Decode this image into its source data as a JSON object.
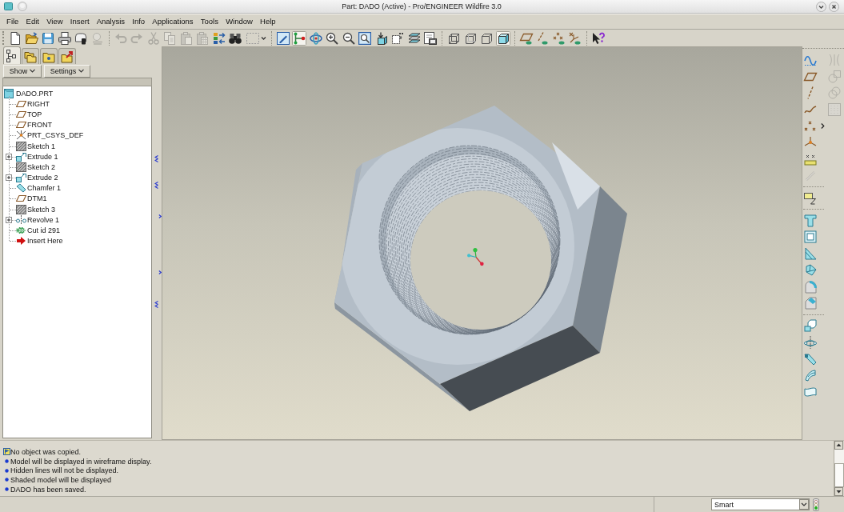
{
  "window": {
    "title": "Part: DADO (Active) - Pro/ENGINEER Wildfire 3.0"
  },
  "menu": [
    "File",
    "Edit",
    "View",
    "Insert",
    "Analysis",
    "Info",
    "Applications",
    "Tools",
    "Window",
    "Help"
  ],
  "toolbar": {
    "groups": [
      {
        "items": [
          {
            "disabled": false,
            "pressed": false
          },
          {
            "disabled": false,
            "pressed": false
          },
          {
            "disabled": false,
            "pressed": false
          },
          {
            "disabled": false,
            "pressed": false
          },
          {
            "disabled": false,
            "pressed": false
          },
          {
            "disabled": true,
            "pressed": false
          }
        ]
      },
      {
        "items": [
          {
            "disabled": true,
            "pressed": false
          },
          {
            "disabled": true,
            "pressed": false
          },
          {
            "disabled": true,
            "pressed": false
          },
          {
            "disabled": true,
            "pressed": false
          },
          {
            "disabled": true,
            "pressed": false
          },
          {
            "disabled": true,
            "pressed": false
          },
          {
            "disabled": false,
            "pressed": false
          },
          {
            "disabled": false,
            "pressed": false
          },
          {
            "disabled": false,
            "pressed": false
          }
        ]
      },
      {
        "items": [
          {
            "disabled": false,
            "pressed": false
          },
          {
            "disabled": false,
            "pressed": true
          },
          {
            "disabled": false,
            "pressed": false
          },
          {
            "disabled": false,
            "pressed": false
          },
          {
            "disabled": false,
            "pressed": false
          },
          {
            "disabled": false,
            "pressed": false
          },
          {
            "disabled": false,
            "pressed": false
          },
          {
            "disabled": false,
            "pressed": false
          },
          {
            "disabled": false,
            "pressed": false
          },
          {
            "disabled": false,
            "pressed": false
          }
        ]
      },
      {
        "items": [
          {
            "disabled": false,
            "pressed": false
          },
          {
            "disabled": false,
            "pressed": false
          },
          {
            "disabled": false,
            "pressed": false
          },
          {
            "disabled": false,
            "pressed": true
          }
        ]
      },
      {
        "items": [
          {
            "disabled": false,
            "pressed": false
          },
          {
            "disabled": false,
            "pressed": false
          },
          {
            "disabled": false,
            "pressed": false
          },
          {
            "disabled": false,
            "pressed": false
          }
        ]
      },
      {
        "items": [
          {
            "disabled": false,
            "pressed": false
          }
        ]
      }
    ]
  },
  "model_tree": {
    "tabs": [
      {
        "selected": true
      },
      {
        "selected": false
      },
      {
        "selected": false
      },
      {
        "selected": false
      }
    ],
    "show_button": "Show",
    "settings_button": "Settings",
    "items": [
      {
        "label": "DADO.PRT",
        "kind": "part",
        "children": [
          {
            "label": "RIGHT",
            "kind": "plane",
            "collapsed": false
          },
          {
            "label": "TOP",
            "kind": "plane",
            "collapsed": false
          },
          {
            "label": "FRONT",
            "kind": "plane",
            "collapsed": false
          },
          {
            "label": "PRT_CSYS_DEF",
            "kind": "csys",
            "collapsed": false
          },
          {
            "label": "Sketch 1",
            "kind": "sketch",
            "collapsed": false
          },
          {
            "label": "Extrude 1",
            "kind": "extrude",
            "collapsed": true
          },
          {
            "label": "Sketch 2",
            "kind": "sketch",
            "collapsed": false
          },
          {
            "label": "Extrude 2",
            "kind": "extrude",
            "collapsed": true
          },
          {
            "label": "Chamfer 1",
            "kind": "chamfer",
            "collapsed": false
          },
          {
            "label": "DTM1",
            "kind": "plane",
            "collapsed": false
          },
          {
            "label": "Sketch 3",
            "kind": "sketch",
            "collapsed": false
          },
          {
            "label": "Revolve 1",
            "kind": "revolve",
            "collapsed": true
          },
          {
            "label": "Cut id 291",
            "kind": "cut",
            "collapsed": false
          },
          {
            "label": "Insert Here",
            "kind": "insert",
            "collapsed": false
          }
        ]
      }
    ]
  },
  "right_toolbar": {
    "groups": [
      {
        "items": [
          {
            "disabled": false
          },
          {
            "disabled": false
          },
          {
            "disabled": false
          },
          {
            "disabled": false
          },
          {
            "disabled": false
          },
          {
            "disabled": false
          },
          {
            "disabled": false
          },
          {
            "disabled": true
          }
        ]
      },
      {
        "items": [
          {
            "disabled": false
          }
        ]
      },
      {
        "items": [
          {
            "disabled": false
          },
          {
            "disabled": false
          },
          {
            "disabled": false
          },
          {
            "disabled": false
          },
          {
            "disabled": false
          },
          {
            "disabled": false
          }
        ]
      },
      {
        "items": [
          {
            "disabled": false
          },
          {
            "disabled": false
          },
          {
            "disabled": false
          },
          {
            "disabled": false
          },
          {
            "disabled": false
          }
        ]
      }
    ],
    "secondary": [
      {
        "disabled": true
      },
      {
        "disabled": true
      },
      {
        "disabled": true
      },
      {
        "disabled": true
      }
    ]
  },
  "messages": [
    {
      "kind": "info",
      "text": "No object was copied."
    },
    {
      "kind": "bullet",
      "text": "Model will be displayed in wireframe display."
    },
    {
      "kind": "bullet",
      "text": "Hidden lines will not be displayed."
    },
    {
      "kind": "bullet",
      "text": "Shaded model will be displayed"
    },
    {
      "kind": "bullet",
      "text": "DADO has been saved."
    }
  ],
  "status_bar": {
    "selection_filter": "Smart"
  }
}
